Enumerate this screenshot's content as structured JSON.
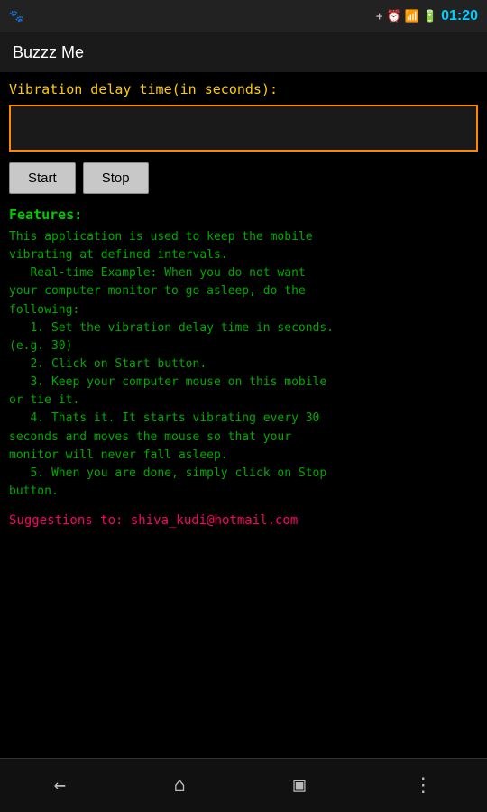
{
  "statusBar": {
    "time": "01:20",
    "icons": [
      "bluetooth",
      "alarm",
      "signal",
      "battery"
    ]
  },
  "titleBar": {
    "title": "Buzzz Me"
  },
  "main": {
    "vibrationLabel": "Vibration delay time(in seconds):",
    "inputPlaceholder": "",
    "inputValue": "",
    "startLabel": "Start",
    "stopLabel": "Stop",
    "featuresTitle": "Features:",
    "featuresText": "This application is used to keep the mobile\nvibrating at defined intervals.\n   Real-time Example: When you do not want\nyour computer monitor to go asleep, do the\nfollowing:\n   1. Set the vibration delay time in seconds.\n(e.g. 30)\n   2. Click on Start button.\n   3. Keep your computer mouse on this mobile\nor tie it.\n   4. Thats it. It starts vibrating every 30\nseconds and moves the mouse so that your\nmonitor will never fall asleep.\n   5. When you are done, simply click on Stop\nbutton.",
    "suggestions": "Suggestions to: shiva_kudi@hotmail.com"
  },
  "navBar": {
    "back": "←",
    "home": "⌂",
    "recents": "▣",
    "menu": "⋮"
  }
}
